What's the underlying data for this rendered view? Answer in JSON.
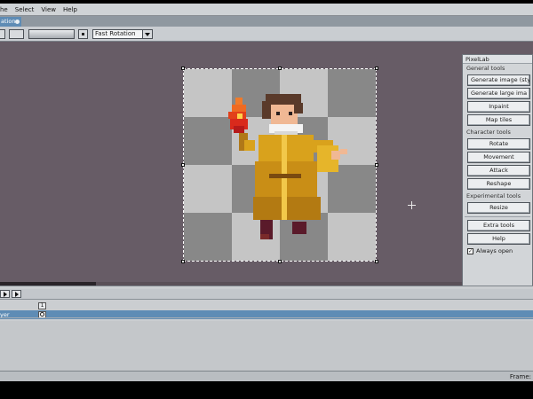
{
  "menubar": {
    "items": [
      "he",
      "Select",
      "View",
      "Help"
    ]
  },
  "tab": {
    "label": "ation"
  },
  "toolbar": {
    "rotation_select": "Fast Rotation"
  },
  "panel": {
    "title": "PixelLab",
    "general_header": "General tools",
    "general_buttons": [
      "Generate image (sty",
      "Generate large ima",
      "Inpaint",
      "Map tiles"
    ],
    "character_header": "Character tools",
    "character_buttons": [
      "Rotate",
      "Movement",
      "Attack",
      "Reshape"
    ],
    "experimental_header": "Experimental tools",
    "experimental_buttons": [
      "Resize"
    ],
    "extra_buttons": [
      "Extra tools",
      "Help"
    ],
    "always_open": "Always open",
    "always_open_checked": true
  },
  "timeline": {
    "rows": [
      {
        "label": "",
        "frame": "1"
      },
      {
        "label": "yer",
        "frame": ""
      }
    ]
  },
  "statusbar": {
    "frame_label": "Frame:"
  },
  "colors": {
    "workspace": "#675c66",
    "accent": "#5e8cb5",
    "robe": "#d9a21c",
    "fire": "#e2401a"
  }
}
